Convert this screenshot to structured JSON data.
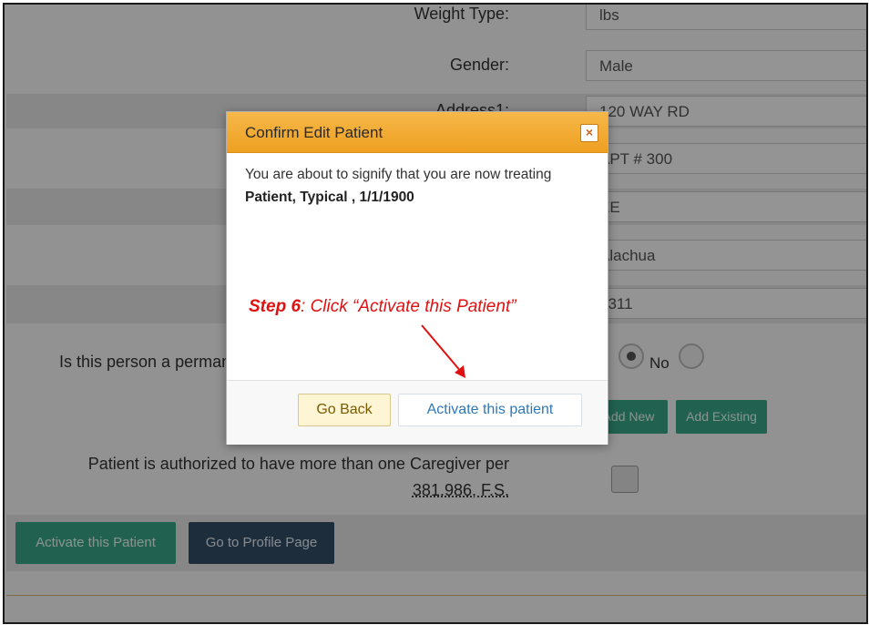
{
  "form": {
    "weight_type": {
      "label": "Weight Type:",
      "value": "lbs"
    },
    "gender": {
      "label": "Gender:",
      "value": "Male"
    },
    "address1": {
      "label": "Address1:",
      "value": "120 WAY RD"
    },
    "address2": {
      "value": "APT # 300"
    },
    "city": {
      "value": "EE"
    },
    "county": {
      "value": "Alachua"
    },
    "zip": {
      "value": "9311"
    },
    "permanent_question": "Is this person a perman",
    "no_label": "No",
    "add_new_label": "Add New",
    "add_existing_label": "Add Existing",
    "caregiver_question_line1": "Patient is authorized to have more than one Caregiver per",
    "caregiver_question_line2": "381.986, F.S.",
    "activate_patient_button": "Activate this Patient",
    "go_to_profile_button": "Go to Profile Page"
  },
  "modal": {
    "title": "Confirm Edit Patient",
    "close_symbol": "×",
    "body_text": "You are about to signify that you are now treating",
    "patient_info": "Patient, Typical , 1/1/1900",
    "go_back_label": "Go Back",
    "activate_label": "Activate this patient"
  },
  "annotation": {
    "step_prefix": "Step 6",
    "step_text": ": Click “Activate this Patient”"
  },
  "colors": {
    "header_orange": "#eea021",
    "annotation_red": "#e01111",
    "green_button": "#3aa78b",
    "blue_button": "#344e68"
  }
}
